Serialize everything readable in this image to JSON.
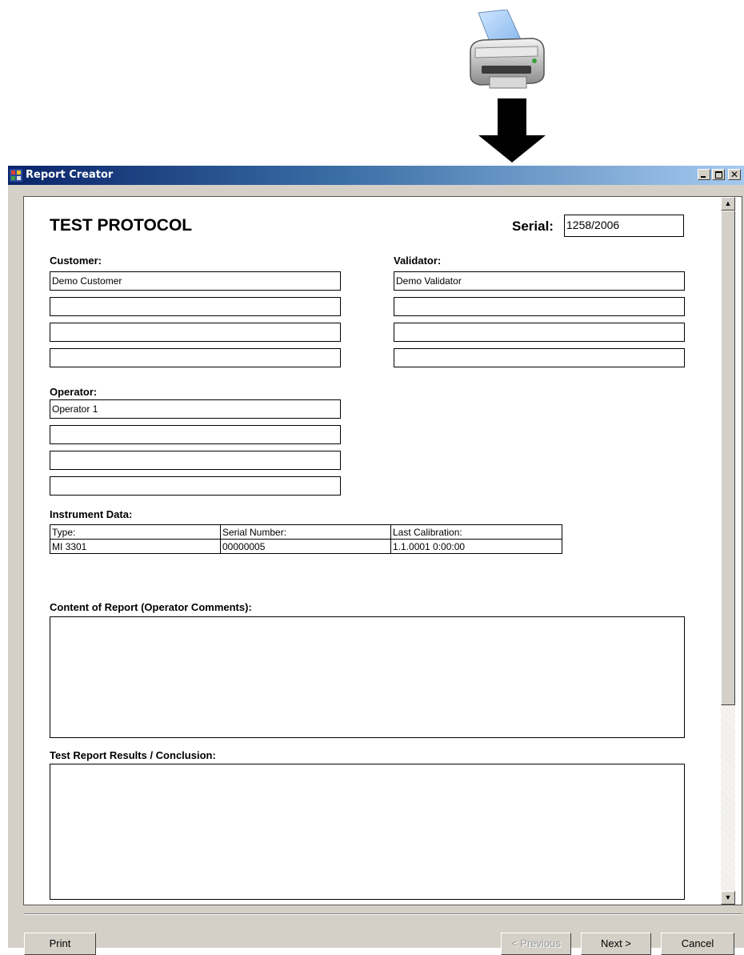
{
  "window": {
    "title": "Report Creator",
    "icons": [
      "app-icon",
      "minimize-icon",
      "maximize-icon",
      "close-icon"
    ]
  },
  "illustration": {
    "icons": [
      "printer-icon",
      "arrow-down-icon"
    ]
  },
  "report": {
    "title": "TEST PROTOCOL",
    "serial_label": "Serial:",
    "serial_value": "1258/2006",
    "customer": {
      "label": "Customer:",
      "lines": [
        "Demo Customer",
        "",
        "",
        ""
      ]
    },
    "validator": {
      "label": "Validator:",
      "lines": [
        "Demo Validator",
        "",
        "",
        ""
      ]
    },
    "operator": {
      "label": "Operator:",
      "lines": [
        "Operator 1",
        "",
        "",
        ""
      ]
    },
    "instrument": {
      "label": "Instrument Data:",
      "headers": [
        "Type:",
        "Serial Number:",
        "Last Calibration:"
      ],
      "values": [
        "MI 3301",
        "00000005",
        "1.1.0001 0:00:00"
      ]
    },
    "content_label": "Content of Report (Operator Comments):",
    "content_value": "",
    "results_label": "Test Report Results / Conclusion:",
    "results_value": ""
  },
  "buttons": {
    "print": "Print",
    "previous": "< Previous",
    "next": "Next >",
    "cancel": "Cancel"
  },
  "colors": {
    "titlebar_start": "#0a246a",
    "titlebar_end": "#a6caf0",
    "face": "#d4d0c8"
  }
}
